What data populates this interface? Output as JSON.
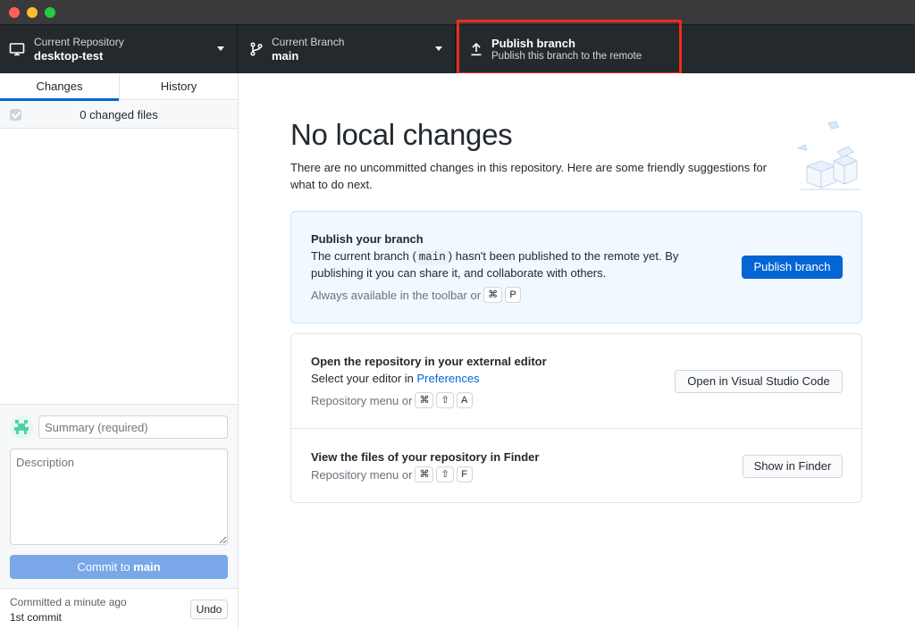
{
  "window": {
    "traffic_lights": [
      "close",
      "minimize",
      "zoom"
    ]
  },
  "toolbar": {
    "repository": {
      "label": "Current Repository",
      "value": "desktop-test",
      "icon": "monitor-icon"
    },
    "branch": {
      "label": "Current Branch",
      "value": "main",
      "icon": "git-branch-icon"
    },
    "publish": {
      "label": "Publish branch",
      "value": "Publish this branch to the remote",
      "icon": "upload-arrow-icon"
    }
  },
  "sidebar": {
    "tabs": [
      {
        "label": "Changes",
        "active": true
      },
      {
        "label": "History",
        "active": false
      }
    ],
    "changes_count": "0 changed files",
    "commit": {
      "summary_placeholder": "Summary (required)",
      "description_placeholder": "Description",
      "button_prefix": "Commit to ",
      "button_branch": "main"
    },
    "last_commit": {
      "time": "Committed a minute ago",
      "message": "1st commit",
      "undo_label": "Undo"
    }
  },
  "main": {
    "title": "No local changes",
    "description": "There are no uncommitted changes in this repository. Here are some friendly suggestions for what to do next.",
    "publish_card": {
      "title": "Publish your branch",
      "body_pre": "The current branch (",
      "body_branch": "main",
      "body_post": ") hasn't been published to the remote yet. By",
      "body_line2": "publishing it you can share it, and collaborate with others.",
      "hint": "Always available in the toolbar or",
      "keys": [
        "⌘",
        "P"
      ],
      "button": "Publish branch"
    },
    "editor_card": {
      "title": "Open the repository in your external editor",
      "body": "Select your editor in ",
      "link": "Preferences",
      "hint": "Repository menu or",
      "keys": [
        "⌘",
        "⇧",
        "A"
      ],
      "button": "Open in Visual Studio Code"
    },
    "finder_card": {
      "title": "View the files of your repository in Finder",
      "hint": "Repository menu or",
      "keys": [
        "⌘",
        "⇧",
        "F"
      ],
      "button": "Show in Finder"
    }
  },
  "colors": {
    "toolbar_bg": "#24292e",
    "accent": "#0366d6",
    "highlight": "#f0291a"
  }
}
